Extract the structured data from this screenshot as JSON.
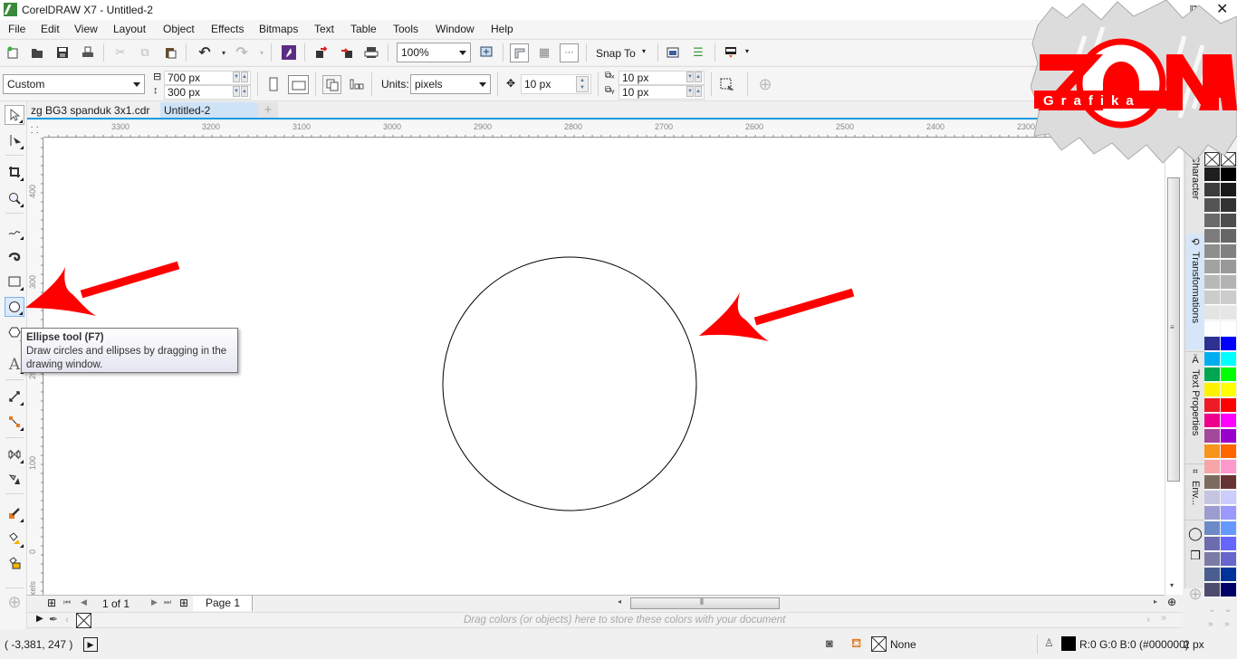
{
  "window": {
    "title": "CorelDRAW X7 - Untitled-2",
    "restore_label": "restore",
    "close_label": "close"
  },
  "menu": [
    "File",
    "Edit",
    "View",
    "Layout",
    "Object",
    "Effects",
    "Bitmaps",
    "Text",
    "Table",
    "Tools",
    "Window",
    "Help"
  ],
  "standard_toolbar": {
    "zoom_level": "100%",
    "snap_to_label": "Snap To"
  },
  "property_bar": {
    "page_preset": "Custom",
    "page_width": "700 px",
    "page_height": "300 px",
    "units_label": "Units:",
    "units_value": "pixels",
    "nudge": "10 px",
    "duplicate_x": "10 px",
    "duplicate_y": "10 px"
  },
  "document_tabs": [
    {
      "label": "zg BG3 spanduk 3x1.cdr",
      "active": false
    },
    {
      "label": "Untitled-2",
      "active": true
    }
  ],
  "rulers": {
    "horizontal_ticks": [
      "3300",
      "3200",
      "3100",
      "3000",
      "2900",
      "2800",
      "2700",
      "2600",
      "2500",
      "2400",
      "2300"
    ],
    "vertical_ticks": [
      "400",
      "300",
      "200",
      "100",
      "0"
    ],
    "unit_label": "pixels"
  },
  "tooltip": {
    "title": "Ellipse tool (F7)",
    "body": "Draw circles and ellipses by dragging in the drawing window."
  },
  "page_navigator": {
    "page_count": "1 of 1",
    "page_tab": "Page 1"
  },
  "palette_tray": {
    "hint": "Drag colors (or objects) here to store these colors with your document"
  },
  "status": {
    "cursor_position": "( -3,381, 247    )",
    "fill_label": "None",
    "outline_color": "R:0 G:0 B:0 (#000000)",
    "outline_width": "2 px"
  },
  "docker_tabs": [
    "Character",
    "Transformations",
    "Text Properties",
    "Env..."
  ],
  "palette": {
    "col1": [
      "#1e1e1e",
      "#3c3c3c",
      "#545454",
      "#6a6a6a",
      "#7c7c7c",
      "#8e8e8e",
      "#a2a2a2",
      "#b8b8b8",
      "#cccccc",
      "#e4e4e4",
      "#ffffff",
      "#2e3192",
      "#00aeef",
      "#00a651",
      "#fff200",
      "#ed1c24",
      "#ec008c",
      "#a3489b",
      "#f7941d",
      "#f6a5a9",
      "#7d6a5e",
      "#c5c5e2",
      "#9c9cce",
      "#6d8ac6",
      "#6c6cae",
      "#7b7ba5",
      "#4a5f8f",
      "#4e4c6e"
    ],
    "col2": [
      "#000000",
      "#1a1a1a",
      "#333333",
      "#4d4d4d",
      "#666666",
      "#808080",
      "#999999",
      "#b3b3b3",
      "#cccccc",
      "#e6e6e6",
      "#ffffff",
      "#0000ff",
      "#00ffff",
      "#00ff00",
      "#ffff00",
      "#ff0000",
      "#ff00ff",
      "#9900cc",
      "#ff6600",
      "#ff99cc",
      "#663333",
      "#ccccff",
      "#9999ff",
      "#6699ff",
      "#6666ff",
      "#6666cc",
      "#003399",
      "#000066"
    ]
  },
  "drawing": {
    "shape": "circle",
    "stroke_color": "#000000",
    "annotation_color": "#ff0000"
  },
  "watermark": {
    "brand": "ZONA",
    "sub": "Grafika"
  }
}
